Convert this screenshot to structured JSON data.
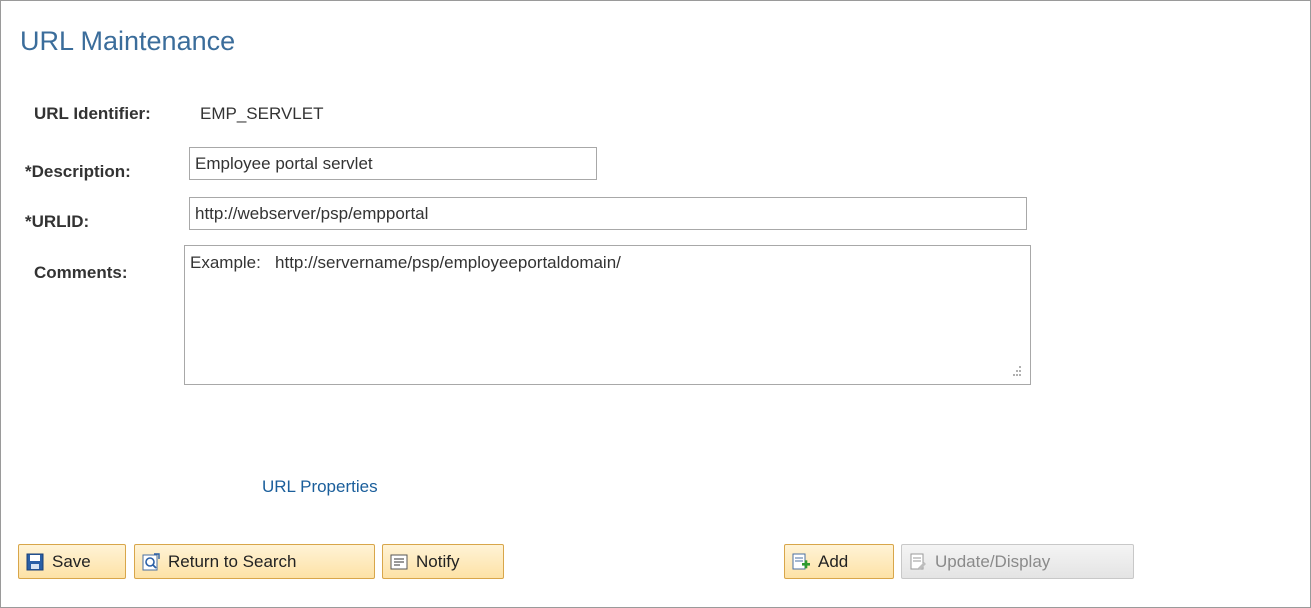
{
  "page": {
    "title": "URL Maintenance"
  },
  "form": {
    "url_identifier": {
      "label": "URL Identifier:",
      "value": "EMP_SERVLET"
    },
    "description": {
      "label": "*Description:",
      "value": "Employee portal servlet"
    },
    "urlid": {
      "label": "*URLID:",
      "value": "http://webserver/psp/empportal"
    },
    "comments": {
      "label": "Comments:",
      "value": "Example:   http://servername/psp/employeeportaldomain/"
    }
  },
  "links": {
    "url_properties": "URL Properties"
  },
  "toolbar": {
    "save": "Save",
    "return_to_search": "Return to Search",
    "notify": "Notify",
    "add": "Add",
    "update_display": "Update/Display"
  },
  "icons": {
    "save": "save-icon",
    "return_to_search": "search-return-icon",
    "notify": "notify-icon",
    "add": "add-icon",
    "update_display": "update-display-icon"
  },
  "colors": {
    "title": "#3b6d9b",
    "link": "#1a5e9b",
    "button_border": "#d8a64a",
    "button_fill": "#fde2a6"
  }
}
